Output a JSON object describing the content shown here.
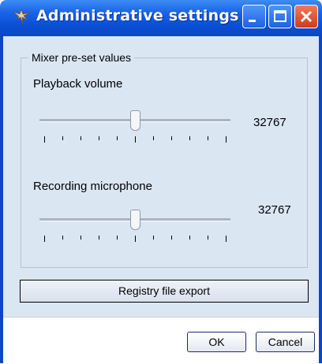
{
  "window": {
    "title": "Administrative settings",
    "colors": {
      "titlebar": "#0b47c2",
      "client_bg": "#dbe6f3",
      "close_button": "#d23a1d"
    },
    "title_icon": "settings-app-icon",
    "controls": [
      "minimize-icon",
      "maximize-icon",
      "close-icon"
    ]
  },
  "mixer": {
    "group_label": "Mixer pre-set values",
    "playback": {
      "label": "Playback volume",
      "value": "32767",
      "slider_fraction": 0.5
    },
    "recording": {
      "label": "Recording microphone",
      "value": "32767",
      "slider_fraction": 0.5
    }
  },
  "actions": {
    "registry_export": "Registry file export",
    "ok": "OK",
    "cancel": "Cancel"
  }
}
